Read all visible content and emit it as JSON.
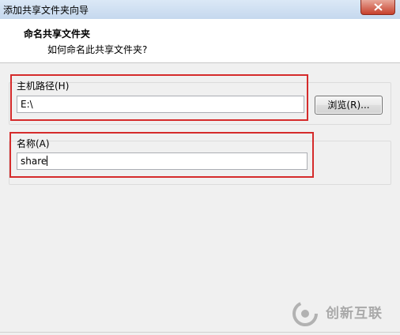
{
  "window": {
    "title": "添加共享文件夹向导"
  },
  "header": {
    "title": "命名共享文件夹",
    "subtitle": "如何命名此共享文件夹?"
  },
  "host_path": {
    "label": "主机路径(H)",
    "value": "E:\\",
    "browse_label": "浏览(R)..."
  },
  "name": {
    "label": "名称(A)",
    "value": "share"
  },
  "watermark": {
    "text": "创新互联"
  },
  "colors": {
    "highlight": "#d52b2b",
    "close_button": "#c7402c"
  }
}
